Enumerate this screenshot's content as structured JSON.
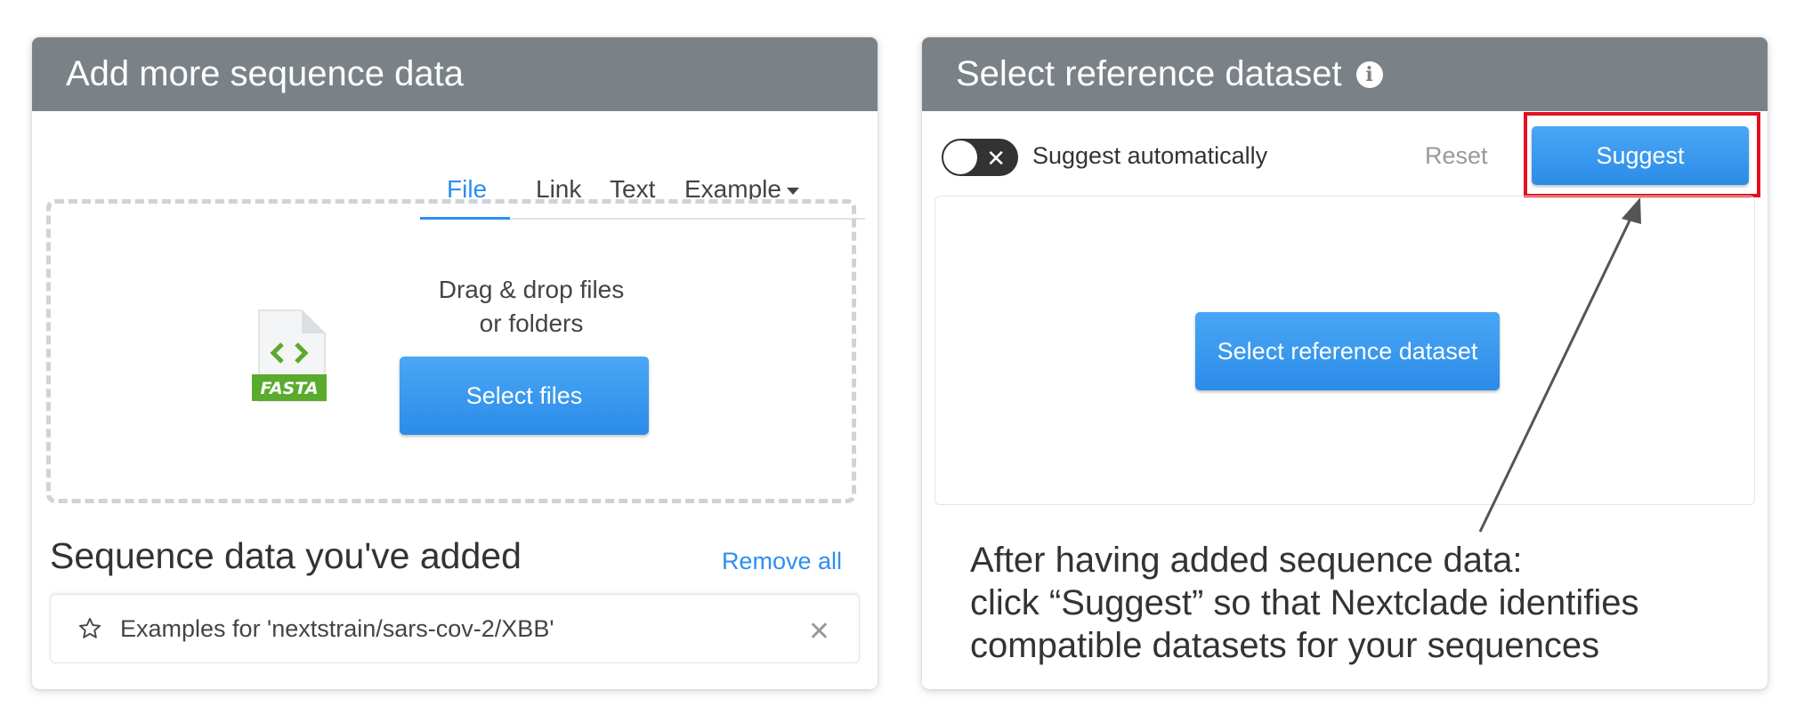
{
  "left_card": {
    "title": "Add more sequence data",
    "tabs": [
      {
        "label": "File",
        "active": true
      },
      {
        "label": "Link",
        "active": false
      },
      {
        "label": "Text",
        "active": false
      },
      {
        "label": "Example",
        "active": false
      }
    ],
    "dropzone": {
      "line1": "Drag & drop files",
      "line2": "or folders",
      "icon_label": "FASTA",
      "button": "Select files"
    },
    "added_title": "Sequence data you've added",
    "remove_all": "Remove all",
    "items": [
      {
        "label": "Examples for 'nextstrain/sars-cov-2/XBB'"
      }
    ]
  },
  "right_card": {
    "title": "Select reference dataset",
    "info_icon": "i",
    "toggle_label": "Suggest automatically",
    "reset": "Reset",
    "suggest": "Suggest",
    "select_button": "Select reference dataset"
  },
  "annotation": {
    "line1": "After having added sequence data:",
    "line2": "click “Suggest” so that Nextclade identifies",
    "line3": "compatible datasets for your sequences"
  },
  "colors": {
    "header": "#7b8287",
    "accent": "#2d8ff2",
    "highlight": "#e3101f",
    "fasta_green": "#5aaa2e"
  }
}
